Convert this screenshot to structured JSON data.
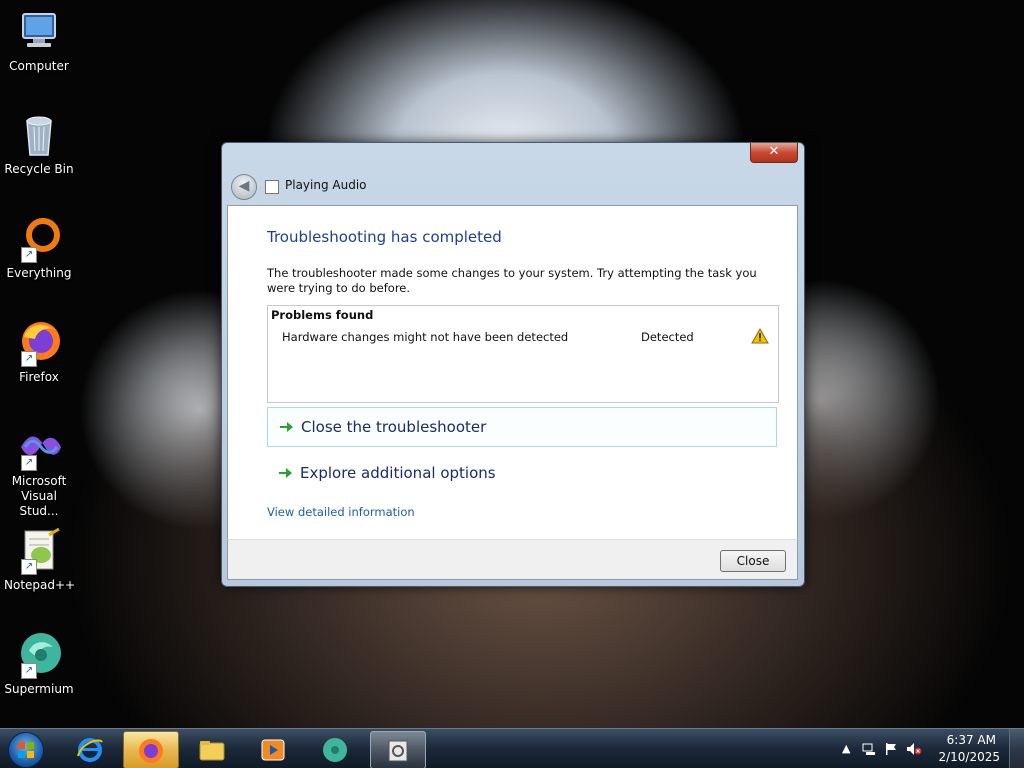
{
  "desktop": {
    "icons": [
      {
        "label": "Computer",
        "icon": "computer-icon"
      },
      {
        "label": "Recycle Bin",
        "icon": "recycle-bin-icon"
      },
      {
        "label": "Everything",
        "icon": "everything-icon"
      },
      {
        "label": "Firefox",
        "icon": "firefox-icon"
      },
      {
        "label": "Microsoft Visual Stud...",
        "icon": "visual-studio-icon"
      },
      {
        "label": "Notepad++",
        "icon": "notepadpp-icon"
      },
      {
        "label": "Supermium",
        "icon": "supermium-icon"
      }
    ]
  },
  "dialog": {
    "title": "Playing Audio",
    "close_glyph": "✕",
    "heading": "Troubleshooting has completed",
    "message": "The troubleshooter made some changes to your system. Try attempting the task you were trying to do before.",
    "problems": {
      "header": "Problems found",
      "rows": [
        {
          "name": "Hardware changes might not have been detected",
          "status": "Detected",
          "icon": "warning-icon"
        }
      ]
    },
    "actions": [
      {
        "label": "Close the troubleshooter"
      },
      {
        "label": "Explore additional options"
      }
    ],
    "details_link": "View detailed information",
    "close_button": "Close"
  },
  "taskbar": {
    "items": [
      {
        "name": "internet-explorer",
        "state": "pinned"
      },
      {
        "name": "firefox",
        "state": "active"
      },
      {
        "name": "file-explorer",
        "state": "pinned"
      },
      {
        "name": "media-player",
        "state": "pinned"
      },
      {
        "name": "supermium",
        "state": "pinned"
      },
      {
        "name": "troubleshooter",
        "state": "open"
      }
    ],
    "clock": {
      "time": "6:37 AM",
      "date": "2/10/2025"
    }
  },
  "colors": {
    "heading": "#1c3f94",
    "link": "#1b5fa9",
    "action_border": "#a7d8ef",
    "arrow": "#2aa12a",
    "warning": "#f2c200"
  }
}
